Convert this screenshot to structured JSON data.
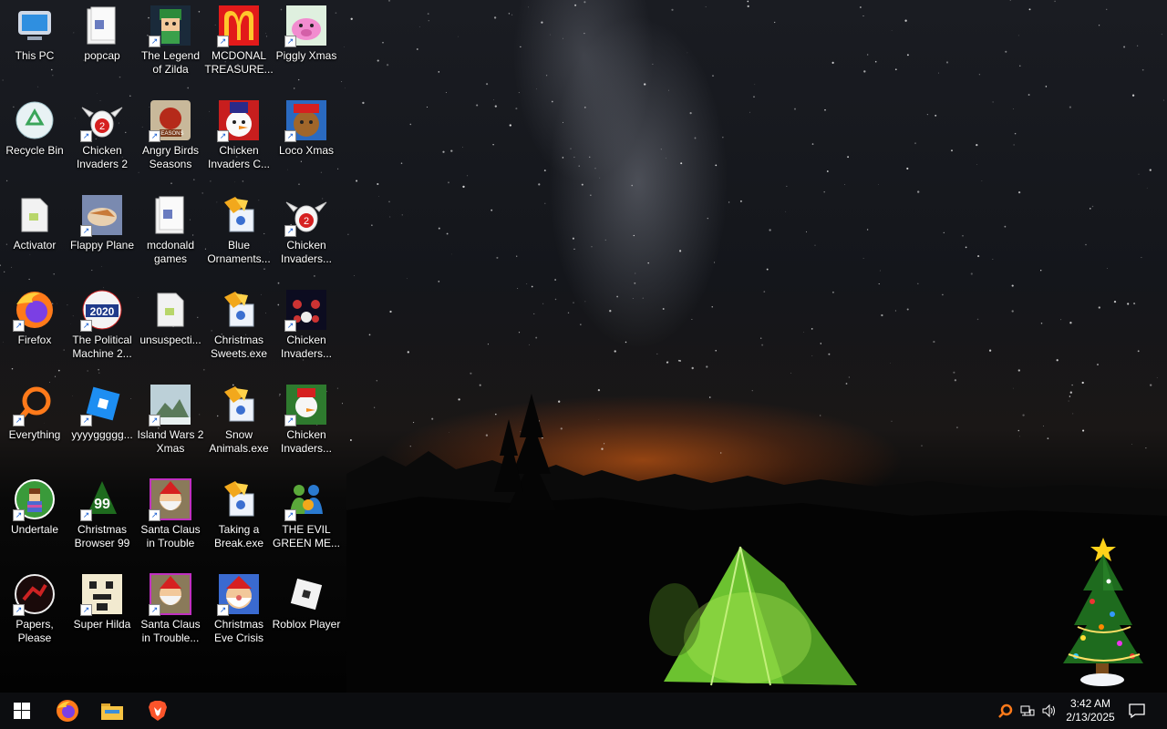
{
  "desktop": {
    "icons": [
      {
        "label": "This PC",
        "icon": "this-pc-icon",
        "shortcut": false
      },
      {
        "label": "popcap",
        "icon": "folder-icon",
        "shortcut": false
      },
      {
        "label": "The Legend of Zilda",
        "icon": "game-zilda-icon",
        "shortcut": true
      },
      {
        "label": "MCDONAL TREASURE...",
        "icon": "mcdonalds-icon",
        "shortcut": true
      },
      {
        "label": "Piggly Xmas",
        "icon": "pig-icon",
        "shortcut": true
      },
      {
        "label": "Recycle Bin",
        "icon": "recycle-bin-icon",
        "shortcut": false
      },
      {
        "label": "Chicken Invaders 2",
        "icon": "chicken-icon",
        "shortcut": true
      },
      {
        "label": "Angry Birds Seasons",
        "icon": "angry-birds-icon",
        "shortcut": true
      },
      {
        "label": "Chicken Invaders C...",
        "icon": "snowman-chicken-icon",
        "shortcut": true
      },
      {
        "label": "Loco Xmas",
        "icon": "bear-icon",
        "shortcut": true
      },
      {
        "label": "Activator",
        "icon": "file-icon",
        "shortcut": false
      },
      {
        "label": "Flappy Plane",
        "icon": "plane-icon",
        "shortcut": true
      },
      {
        "label": "mcdonald games",
        "icon": "folder-icon",
        "shortcut": false
      },
      {
        "label": "Blue Ornaments...",
        "icon": "installer-icon",
        "shortcut": false
      },
      {
        "label": "Chicken Invaders...",
        "icon": "chicken-icon",
        "shortcut": true
      },
      {
        "label": "Firefox",
        "icon": "firefox-icon",
        "shortcut": true
      },
      {
        "label": "The Political Machine 2...",
        "icon": "political-2020-icon",
        "shortcut": true
      },
      {
        "label": "unsuspecti...",
        "icon": "file-icon",
        "shortcut": false
      },
      {
        "label": "Christmas Sweets.exe",
        "icon": "installer-icon",
        "shortcut": false
      },
      {
        "label": "Chicken Invaders...",
        "icon": "chicken-ships-icon",
        "shortcut": true
      },
      {
        "label": "Everything",
        "icon": "everything-search-icon",
        "shortcut": true
      },
      {
        "label": "yyyyggggg...",
        "icon": "roblox-studio-icon",
        "shortcut": true
      },
      {
        "label": "Island Wars 2 Xmas",
        "icon": "island-icon",
        "shortcut": true
      },
      {
        "label": "Snow Animals.exe",
        "icon": "installer-icon",
        "shortcut": false
      },
      {
        "label": "Chicken Invaders...",
        "icon": "chicken-xmas-icon",
        "shortcut": true
      },
      {
        "label": "Undertale",
        "icon": "undertale-icon",
        "shortcut": true
      },
      {
        "label": "Christmas Browser 99",
        "icon": "xmas-tree-99-icon",
        "shortcut": true
      },
      {
        "label": "Santa Claus in Trouble",
        "icon": "santa-icon",
        "shortcut": true
      },
      {
        "label": "Taking a Break.exe",
        "icon": "installer-icon",
        "shortcut": false
      },
      {
        "label": "THE EVIL GREEN ME...",
        "icon": "messenger-icon",
        "shortcut": true
      },
      {
        "label": "Papers, Please",
        "icon": "papers-please-icon",
        "shortcut": true
      },
      {
        "label": "Super Hilda",
        "icon": "pixel-hilda-icon",
        "shortcut": true
      },
      {
        "label": "Santa Claus in Trouble...",
        "icon": "santa-icon",
        "shortcut": true
      },
      {
        "label": "Christmas Eve Crisis",
        "icon": "santa-face-icon",
        "shortcut": true
      },
      {
        "label": "Roblox Player",
        "icon": "roblox-icon",
        "shortcut": false
      }
    ]
  },
  "taskbar": {
    "pinned": [
      {
        "name": "start",
        "icon": "windows-logo-icon"
      },
      {
        "name": "firefox",
        "icon": "firefox-icon"
      },
      {
        "name": "file-explorer",
        "icon": "folder-icon"
      },
      {
        "name": "brave",
        "icon": "brave-icon"
      }
    ],
    "tray": {
      "icons": [
        "everything-search-icon",
        "network-icon",
        "volume-icon"
      ],
      "time": "3:42 AM",
      "date": "2/13/2025",
      "notification_icon": "action-center-icon"
    }
  },
  "colors": {
    "accent": "#0078d7",
    "taskbar": "#0c0d10",
    "tent": "#7fd43a",
    "glow": "#ff6a14"
  }
}
